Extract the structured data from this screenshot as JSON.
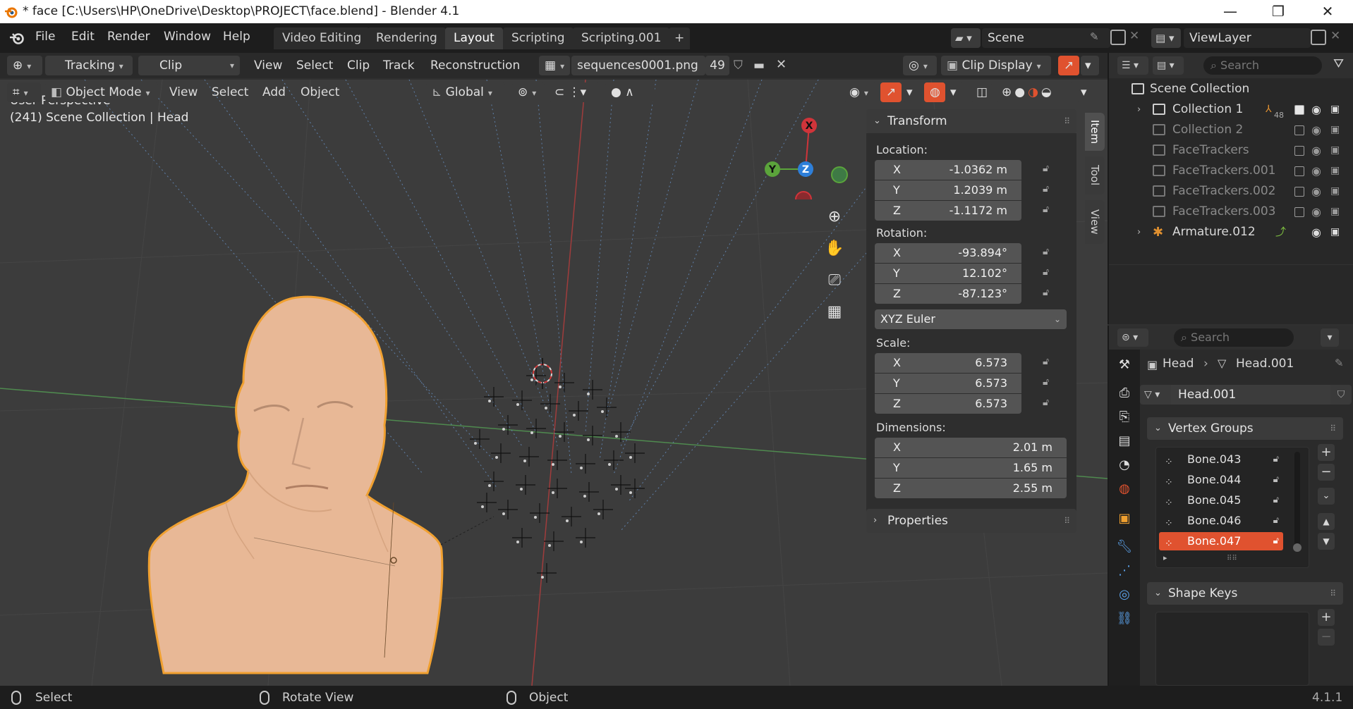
{
  "window": {
    "title": "* face [C:\\Users\\HP\\OneDrive\\Desktop\\PROJECT\\face.blend] - Blender 4.1",
    "minimize": "—",
    "restore": "❐",
    "close": "✕"
  },
  "menu": [
    "File",
    "Edit",
    "Render",
    "Window",
    "Help"
  ],
  "workspaces": {
    "tabs": [
      "Video Editing",
      "Rendering",
      "Layout",
      "Scripting",
      "Scripting.001"
    ],
    "active": "Layout",
    "add": "+"
  },
  "scene": {
    "label": "Scene",
    "view_layer": "ViewLayer"
  },
  "clip_header": {
    "mode": "Tracking",
    "view": "Clip",
    "menus": [
      "View",
      "Select",
      "Clip",
      "Track",
      "Reconstruction"
    ],
    "clip_name": "sequences0001.png",
    "clip_users": "49",
    "display": "Clip Display"
  },
  "viewport_header": {
    "mode": "Object Mode",
    "menus": [
      "View",
      "Select",
      "Add",
      "Object"
    ],
    "orientation": "Global"
  },
  "viewport": {
    "perspective": "User Perspective",
    "collection_info": "(241) Scene Collection | Head",
    "gizmo": {
      "x": "X",
      "y": "Y",
      "z": "Z"
    }
  },
  "transform_panel": {
    "title": "Transform",
    "location_label": "Location:",
    "location": [
      {
        "axis": "X",
        "value": "-1.0362 m"
      },
      {
        "axis": "Y",
        "value": "1.2039 m"
      },
      {
        "axis": "Z",
        "value": "-1.1172 m"
      }
    ],
    "rotation_label": "Rotation:",
    "rotation": [
      {
        "axis": "X",
        "value": "-93.894°"
      },
      {
        "axis": "Y",
        "value": "12.102°"
      },
      {
        "axis": "Z",
        "value": "-87.123°"
      }
    ],
    "rotation_mode": "XYZ Euler",
    "scale_label": "Scale:",
    "scale": [
      {
        "axis": "X",
        "value": "6.573"
      },
      {
        "axis": "Y",
        "value": "6.573"
      },
      {
        "axis": "Z",
        "value": "6.573"
      }
    ],
    "dimensions_label": "Dimensions:",
    "dimensions": [
      {
        "axis": "X",
        "value": "2.01 m"
      },
      {
        "axis": "Y",
        "value": "1.65 m"
      },
      {
        "axis": "Z",
        "value": "2.55 m"
      }
    ],
    "properties_title": "Properties"
  },
  "sidebar_tabs": [
    "Item",
    "Tool",
    "View"
  ],
  "outliner": {
    "search_placeholder": "Search",
    "root": "Scene Collection",
    "items": [
      {
        "name": "Collection 1",
        "badge": "48",
        "checked": true,
        "dim": false,
        "expandable": true
      },
      {
        "name": "Collection 2",
        "checked": false,
        "dim": true,
        "expandable": false
      },
      {
        "name": "FaceTrackers",
        "checked": false,
        "dim": true,
        "expandable": false
      },
      {
        "name": "FaceTrackers.001",
        "checked": false,
        "dim": true,
        "expandable": false
      },
      {
        "name": "FaceTrackers.002",
        "checked": false,
        "dim": true,
        "expandable": false
      },
      {
        "name": "FaceTrackers.003",
        "checked": false,
        "dim": true,
        "expandable": false
      },
      {
        "name": "Armature.012",
        "dim": false,
        "expandable": true
      }
    ]
  },
  "properties": {
    "search_placeholder": "Search",
    "breadcrumb_object": "Head",
    "breadcrumb_data": "Head.001",
    "data_name": "Head.001",
    "vertex_groups_title": "Vertex Groups",
    "vertex_groups": [
      "Bone.043",
      "Bone.044",
      "Bone.045",
      "Bone.046",
      "Bone.047"
    ],
    "selected_group": "Bone.047",
    "shape_keys_title": "Shape Keys"
  },
  "statusbar": {
    "select": "Select",
    "rotate": "Rotate View",
    "object": "Object",
    "version": "4.1.1"
  },
  "colors": {
    "accent": "#e0522f",
    "head_skin": "#e8b896",
    "selection_outline": "#f0a030",
    "x_axis": "#d0343a",
    "y_axis": "#5ba43b",
    "z_axis": "#2e7fd9"
  }
}
